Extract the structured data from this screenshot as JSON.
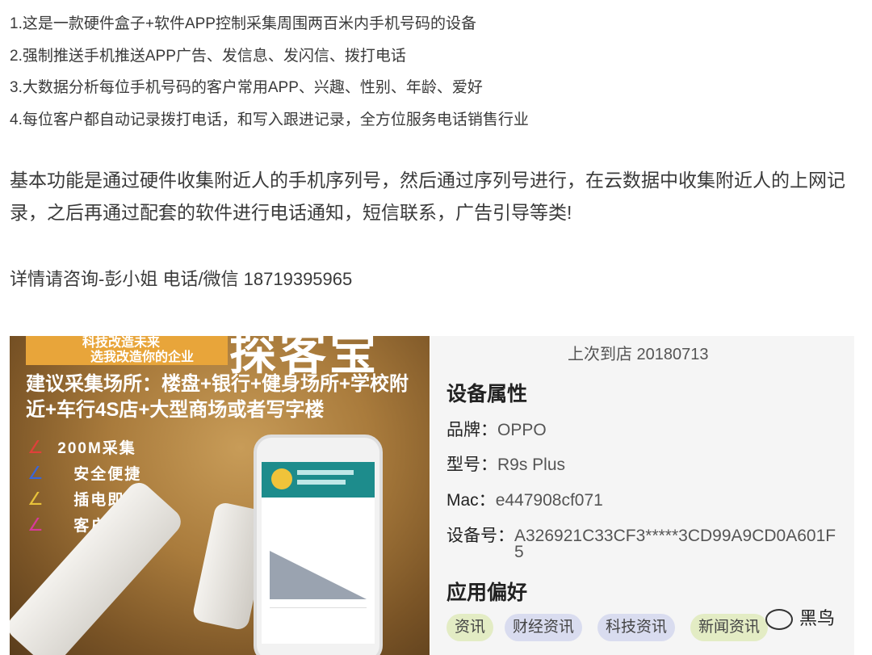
{
  "list": [
    "1.这是一款硬件盒子+软件APP控制采集周围两百米内手机号码的设备",
    "2.强制推送手机推送APP广告、发信息、发闪信、拨打电话",
    "3.大数据分析每位手机号码的客户常用APP、兴趣、性别、年龄、爱好",
    "4.每位客户都自动记录拨打电话，和写入跟进记录，全方位服务电话销售行业"
  ],
  "paragraph": "基本功能是通过硬件收集附近人的手机序列号，然后通过序列号进行，在云数据中收集附近人的上网记录，之后再通过配套的软件进行电话通知，短信联系，广告引导等类!",
  "contact": "详情请咨询-彭小姐 电话/微信 18719395965",
  "ad": {
    "banner_line1": "科技改造未来",
    "banner_line2": "选我改造你的企业",
    "logo": "探客宝",
    "suggest": "建议采集场所：楼盘+银行+健身场所+学校附近+车行4S店+大型商场或者写字楼",
    "features": [
      {
        "text": "200M采集",
        "color": "#e0403a"
      },
      {
        "text": "安全便捷",
        "color": "#3a66d8"
      },
      {
        "text": "插电即用",
        "color": "#e8c23a"
      },
      {
        "text": "客户营销",
        "color": "#d83a9a"
      }
    ]
  },
  "profile": {
    "last_visit": "上次到店 20180713",
    "device_section": "设备属性",
    "brand_label": "品牌：",
    "brand": "OPPO",
    "model_label": "型号：",
    "model": "R9s Plus",
    "mac_label": "Mac：",
    "mac": "e447908cf071",
    "device_id_label": "设备号：",
    "device_id_line1": "A326921C33CF3*****3CD99A9CD0A601F",
    "device_id_line2": "5",
    "pref_section": "应用偏好",
    "tags": [
      {
        "label": "资讯",
        "color": "#e3ecc4"
      },
      {
        "label": "财经资讯",
        "color": "#d9dcef"
      },
      {
        "label": "科技资讯",
        "color": "#d9dcef"
      },
      {
        "label": "新闻资讯",
        "color": "#e3ecc4"
      }
    ]
  },
  "watermark": "黑鸟"
}
